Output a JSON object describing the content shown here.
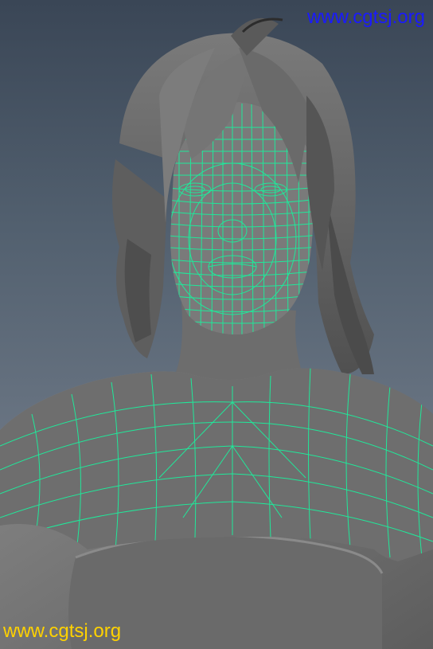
{
  "watermarks": {
    "top": "www.cgtsj.org",
    "bottom": "www.cgtsj.org"
  },
  "colors": {
    "background_top": "#3a4656",
    "background_bottom": "#77818c",
    "mesh_fill": "#747474",
    "wireframe": "#20e89a",
    "watermark_top": "#1a1aff",
    "watermark_bottom": "#ffd200"
  }
}
